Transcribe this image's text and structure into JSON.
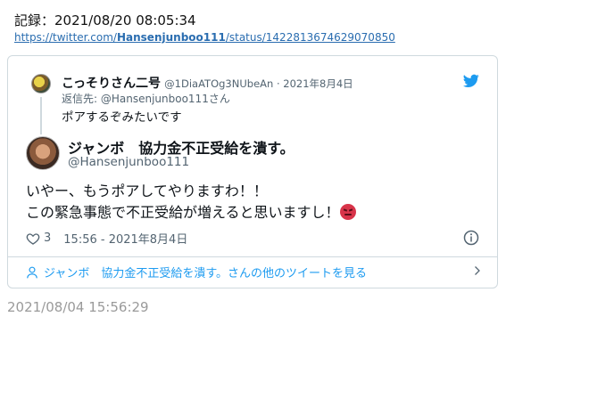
{
  "record": {
    "label": "記録：2021/08/20 08:05:34",
    "link_prefix": "https://twitter.com/",
    "link_user": "Hansenjunboo111",
    "link_suffix": "/status/1422813674629070850"
  },
  "parent_tweet": {
    "name": "こっそりさん二号",
    "meta": "@1DiaATOg3NUbeAn · 2021年8月4日",
    "reply_to": "返信先: @Hansenjunboo111さん",
    "text": "ポアするぞみたいです"
  },
  "main_tweet": {
    "name": "ジャンボ　協力金不正受給を潰す。",
    "handle": "@Hansenjunboo111",
    "line1": "いやー、もうポアしてやりますわ！！",
    "line2": "この緊急事態で不正受給が増えると思いますし！",
    "likes": "3",
    "timestamp": "15:56 - 2021年8月4日"
  },
  "footer": {
    "more_tweets": "ジャンボ　協力金不正受給を潰す。さんの他のツイートを見る"
  },
  "archive_date": "2021/08/04 15:56:29",
  "colors": {
    "link": "#2a6db0",
    "twitter_blue": "#1d9bf0",
    "muted": "#536471",
    "border": "#cfd9de"
  },
  "icons": [
    "twitter-logo-icon",
    "heart-icon",
    "info-icon",
    "person-icon",
    "chevron-right-icon",
    "angry-face-emoji"
  ]
}
